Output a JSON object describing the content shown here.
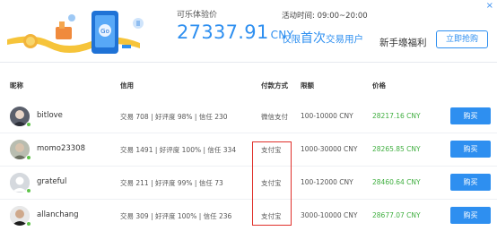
{
  "banner": {
    "close": "×",
    "price_label": "可乐体验价",
    "price_value": "27337.91",
    "price_unit": "CNY",
    "activity_time": "活动时间: 09:00~20:00",
    "activity_prefix": "仅限",
    "activity_emphasis": "首次",
    "activity_suffix": "交易用户",
    "newbie": "新手壕福利",
    "buy_now": "立即抢购",
    "illustration_badge": "Go"
  },
  "table": {
    "headers": {
      "nickname": "昵称",
      "credit": "信用",
      "payment": "付款方式",
      "limit": "限额",
      "price": "价格"
    },
    "rows": [
      {
        "nickname": "bitlove",
        "credit": "交易 708 | 好评度 98% | 信任 230",
        "payment": "微信支付",
        "limit": "100-10000 CNY",
        "price": "28217.16 CNY",
        "buy": "购买",
        "online": true
      },
      {
        "nickname": "momo23308",
        "credit": "交易 1491 | 好评度 100% | 信任 334",
        "payment": "支付宝",
        "limit": "1000-30000 CNY",
        "price": "28265.85 CNY",
        "buy": "购买",
        "online": true
      },
      {
        "nickname": "grateful",
        "credit": "交易 211 | 好评度 99% | 信任 73",
        "payment": "支付宝",
        "limit": "100-12000 CNY",
        "price": "28460.64 CNY",
        "buy": "购买",
        "online": true
      },
      {
        "nickname": "allanchang",
        "credit": "交易 309 | 好评度 100% | 信任 236",
        "payment": "支付宝",
        "limit": "3000-10000 CNY",
        "price": "28677.07 CNY",
        "buy": "购买",
        "online": true
      }
    ]
  },
  "colors": {
    "accent": "#2e8ff0",
    "price_green": "#3fae3f",
    "online_green": "#5fc34a",
    "highlight_red": "#e0302a"
  }
}
